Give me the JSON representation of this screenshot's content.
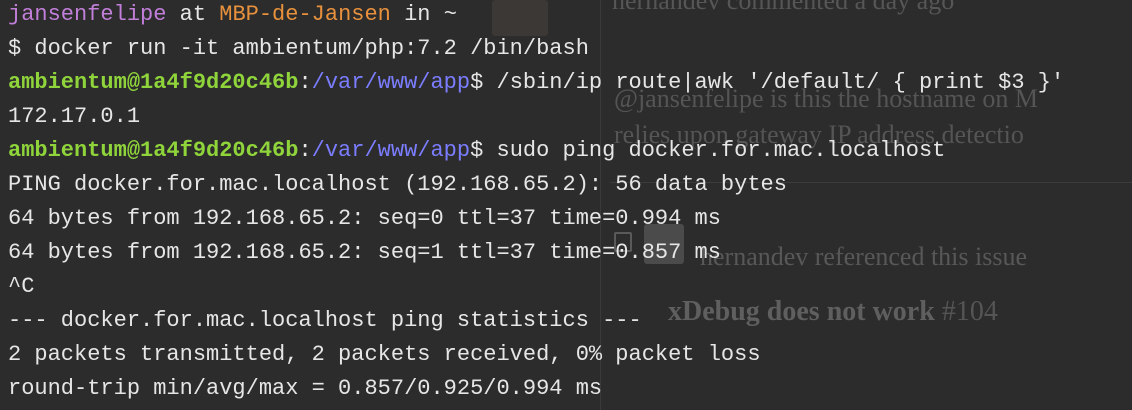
{
  "background": {
    "line1": "hernandev commented a day ago",
    "line2": "@jansenfelipe is this the hostname on M",
    "line3": "relies upon gateway IP address detectio",
    "line4": "hernandev referenced this issue",
    "issue_title": "xDebug does not work",
    "issue_number": "#104"
  },
  "terminal": {
    "header": {
      "user": "jansenfelipe",
      "at": " at ",
      "host": "MBP-de-Jansen",
      "in": " in ",
      "dir": "~"
    },
    "cmd1": "$ docker run -it ambientum/php:7.2 /bin/bash",
    "prompt_user": "ambientum@1a4f9d20c46b",
    "prompt_sep": ":",
    "prompt_path": "/var/www/app",
    "cmd2": "$ /sbin/ip route|awk '/default/ { print $3 }'",
    "out_ip": "172.17.0.1",
    "cmd3": "$ sudo ping docker.for.mac.localhost",
    "out_ping": "PING docker.for.mac.localhost (192.168.65.2): 56 data bytes",
    "out_seq0": "64 bytes from 192.168.65.2: seq=0 ttl=37 time=0.994 ms",
    "out_seq1": "64 bytes from 192.168.65.2: seq=1 ttl=37 time=0.857 ms",
    "out_ctrl": "^C",
    "out_stats_header": "--- docker.for.mac.localhost ping statistics ---",
    "out_packets": "2 packets transmitted, 2 packets received, 0% packet loss",
    "out_rtt": "round-trip min/avg/max = 0.857/0.925/0.994 ms"
  },
  "colors": {
    "user": "#c17fd9",
    "host": "#e8913d",
    "prompt_user": "#8ed43a",
    "prompt_path": "#7b7dff",
    "text": "#e6e6e6",
    "background": "#2c2c2c"
  }
}
